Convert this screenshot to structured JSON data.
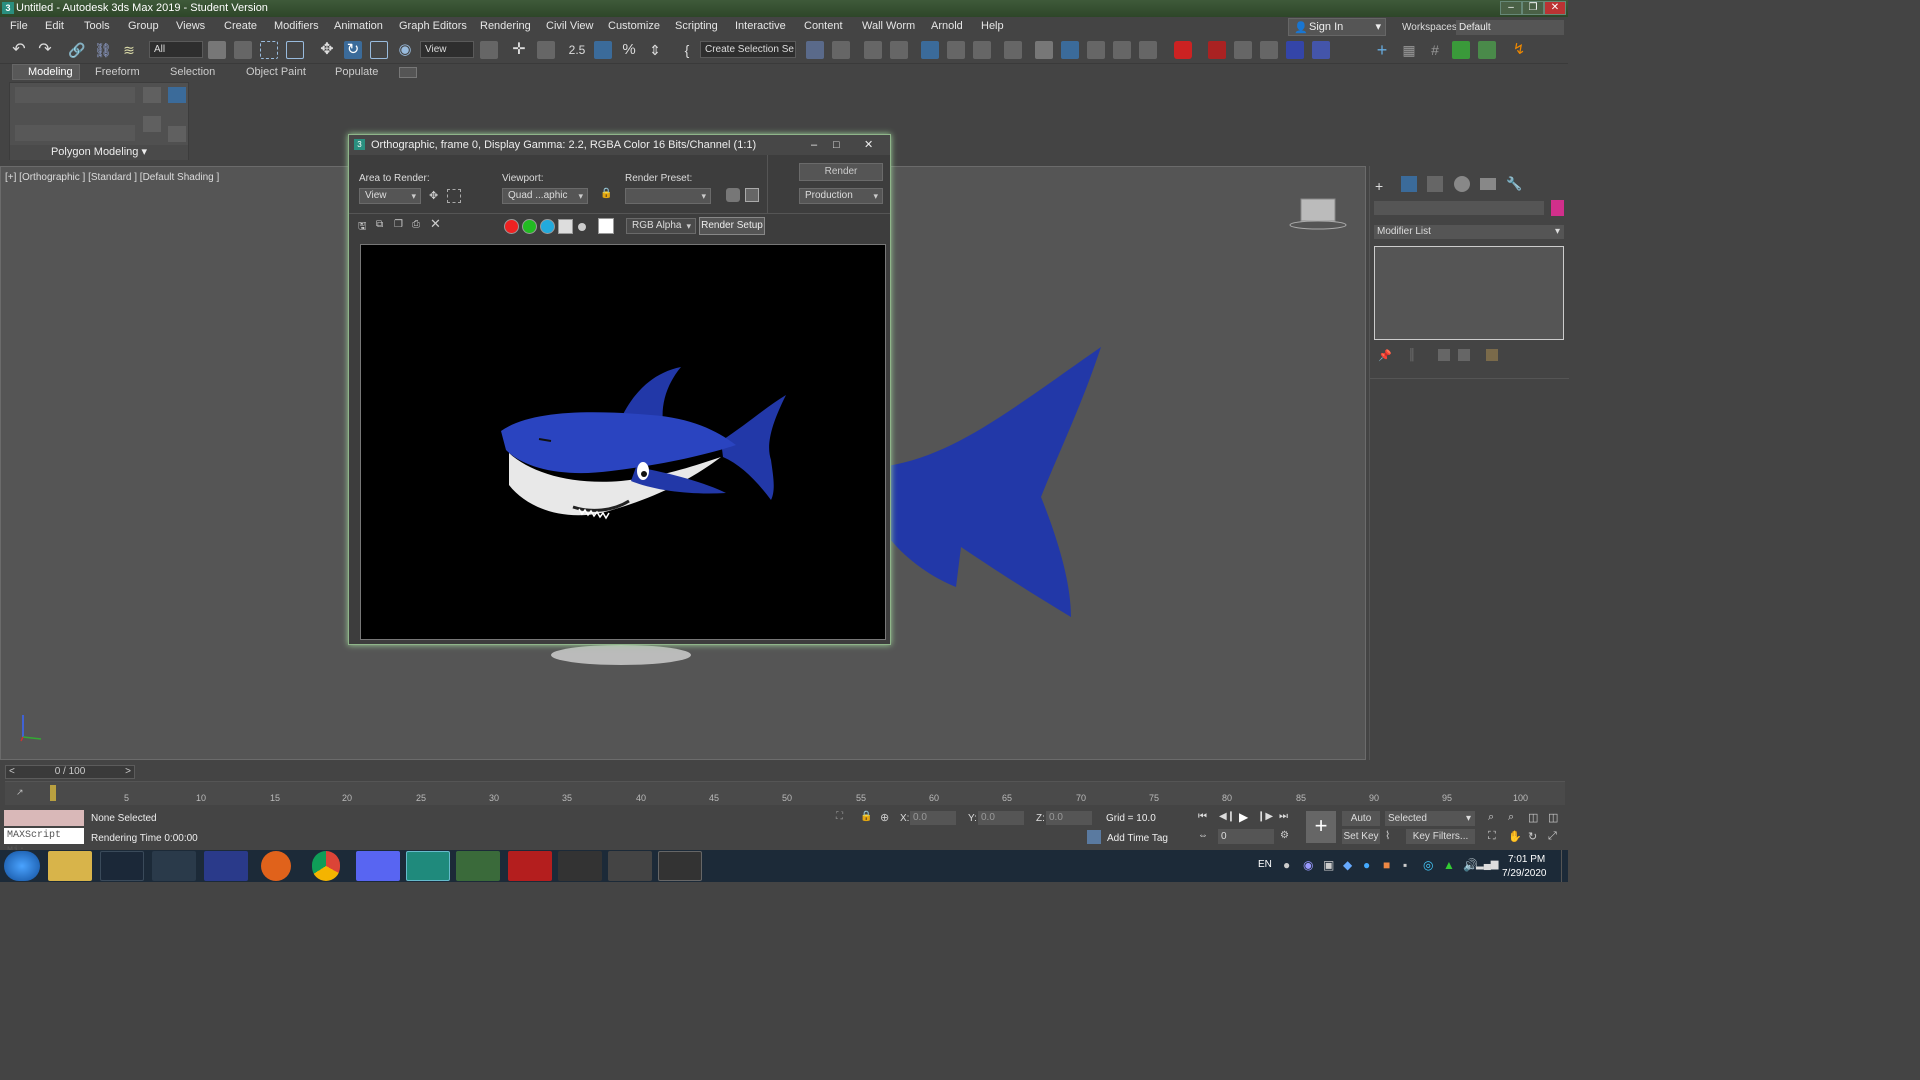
{
  "window": {
    "title": "Untitled - Autodesk 3ds Max 2019 - Student Version"
  },
  "menu": [
    "File",
    "Edit",
    "Tools",
    "Group",
    "Views",
    "Create",
    "Modifiers",
    "Animation",
    "Graph Editors",
    "Rendering",
    "Civil View",
    "Customize",
    "Scripting",
    "Interactive",
    "Content",
    "Wall Worm",
    "Arnold",
    "Help"
  ],
  "signin": "Sign In",
  "workspaces": {
    "label": "Workspaces:",
    "value": "Default"
  },
  "toolbar": {
    "filter": "All",
    "refcoord": "View",
    "selection_set": "Create Selection Se"
  },
  "ribbon": {
    "tabs": [
      "Modeling",
      "Freeform",
      "Selection",
      "Object Paint",
      "Populate"
    ],
    "panel_label": "Polygon Modeling"
  },
  "viewport": {
    "label": "[+] [Orthographic ] [Standard ] [Default Shading ]"
  },
  "render_window": {
    "title": "Orthographic, frame 0, Display Gamma: 2.2, RGBA Color 16 Bits/Channel (1:1)",
    "area_label": "Area to Render:",
    "area_value": "View",
    "viewport_label": "Viewport:",
    "viewport_value": "Quad ...aphic",
    "preset_label": "Render Preset:",
    "preset_value": "",
    "render_button": "Render",
    "production": "Production",
    "channel": "RGB Alpha",
    "tooltip": "Render Setup"
  },
  "command_panel": {
    "modifier_list": "Modifier List"
  },
  "timeline": {
    "frame": "0 / 100",
    "ticks": [
      "5",
      "10",
      "15",
      "20",
      "25",
      "30",
      "35",
      "40",
      "45",
      "50",
      "55",
      "60",
      "65",
      "70",
      "75",
      "80",
      "85",
      "90",
      "95",
      "100"
    ]
  },
  "status": {
    "selection": "None Selected",
    "rendering_time": "Rendering Time  0:00:00",
    "maxscript": "MAXScript Mi:",
    "x_label": "X:",
    "x_value": "0.0",
    "y_label": "Y:",
    "y_value": "0.0",
    "z_label": "Z:",
    "z_value": "0.0",
    "grid": "Grid = 10.0",
    "add_time_tag": "Add Time Tag",
    "auto_key": "Auto Key",
    "set_key": "Set Key",
    "selected": "Selected",
    "key_filters": "Key Filters...",
    "frame_spinner": "0"
  },
  "taskbar": {
    "lang": "EN",
    "time": "7:01 PM",
    "date": "7/29/2020"
  },
  "colors": {
    "accent_green": "#8fb58a",
    "shark_blue": "#2238a8"
  }
}
